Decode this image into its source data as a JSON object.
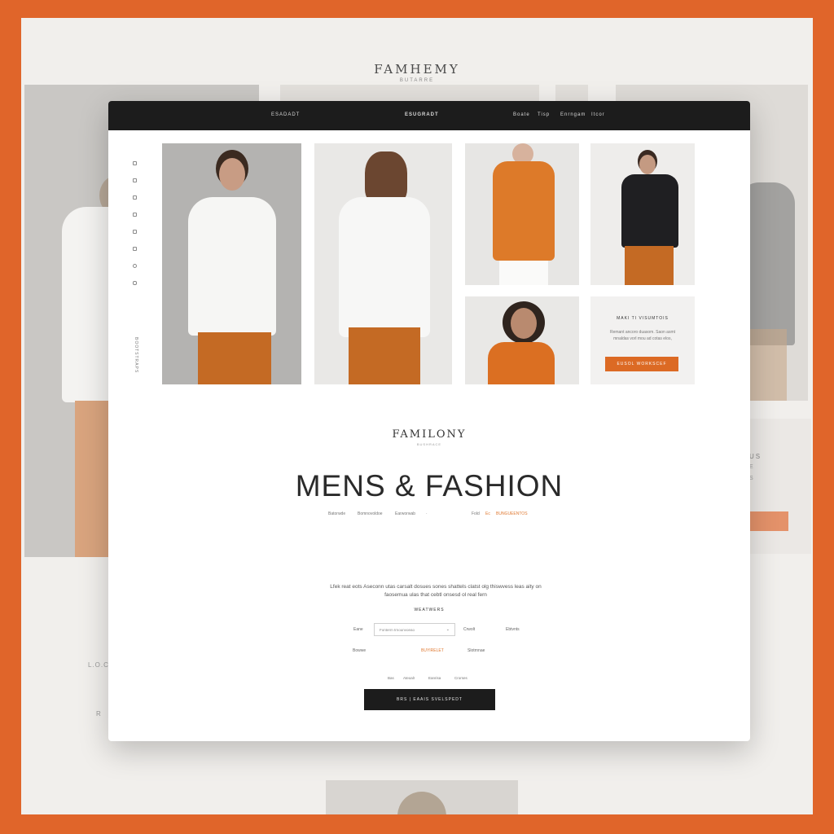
{
  "poster": {
    "brand": "FAMHEMY",
    "subtitle": "BUTARRE",
    "side_text_1": "L.O.C",
    "side_text_2": "R",
    "card_title": "US",
    "card_line_1": "E",
    "card_line_2": "S"
  },
  "topbar": {
    "logo": "ESADADT",
    "brand": "ESUGRADT",
    "nav": [
      "Boate",
      "Tisp",
      "Enrngam",
      "Itcor"
    ]
  },
  "sidebar": {
    "vertical_text": "BOOTSTRAPS"
  },
  "promo": {
    "title": "MAKI TI VISUMTOIS",
    "body": "Remant ancoro duasom. Saon asmt mnaldas vorl mou ad cotas elos,",
    "button": "EUSOL WORKSCEF"
  },
  "hero": {
    "brand": "FAMILONY",
    "brand_sub": "BUSHRACE",
    "headline": "MENS & FASHION",
    "subnav": [
      "Batorwde",
      "Bomnovoldoe",
      "Earworwab",
      "·",
      "Fold",
      "Ec",
      "BUNGUEENTOS"
    ]
  },
  "form": {
    "description": "Lfek reat eots Aseconn utas carsalt dosues sones shattels clatst olg thiswvess leas aity on faosemua ulas that cebtl onsesd ol real fern",
    "label": "WEATWERS",
    "field_label": "Eane",
    "field_placeholder": "Fonterm trnounvoeao",
    "field_chevron": "⌄",
    "side_option": "Crwolt",
    "side_option_2": "Ebtvnts",
    "options": [
      "Bowwe",
      "BUYIRELET",
      "Slotrnnae"
    ],
    "links": [
      "Bas",
      "Ateoalr",
      "Eanrisa",
      "Crorses"
    ],
    "cta": "BRS | EAAIS SVELSPEDT"
  },
  "colors": {
    "accent": "#e0652a",
    "dark": "#1c1c1c",
    "trouser": "#c46a24"
  }
}
